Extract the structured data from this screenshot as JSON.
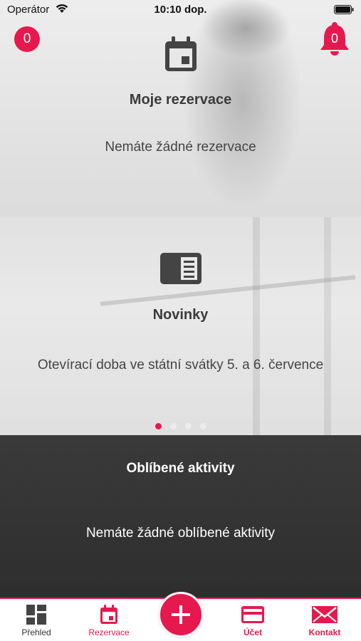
{
  "status_bar": {
    "carrier": "Operátor",
    "time": "10:10 dop."
  },
  "badges": {
    "reservation_count": "0",
    "notification_count": "0"
  },
  "reservations_card": {
    "title": "Moje rezervace",
    "text": "Nemáte žádné rezervace",
    "icon": "calendar-icon"
  },
  "news_card": {
    "title": "Novinky",
    "text": "Otevírací doba ve státní svátky 5. a 6. července",
    "icon": "news-icon",
    "pager": {
      "pages": 4,
      "active_index": 0
    }
  },
  "favorites": {
    "title": "Oblíbené aktivity",
    "text": "Nemáte žádné oblíbené aktivity"
  },
  "tab_bar": {
    "items": [
      {
        "label": "Přehled",
        "icon": "dashboard-icon"
      },
      {
        "label": "Rezervace",
        "icon": "calendar-icon"
      },
      {
        "label": "Účet",
        "icon": "credit-card-icon"
      },
      {
        "label": "Kontakt",
        "icon": "envelope-icon"
      }
    ],
    "center_action_icon": "plus-icon"
  },
  "colors": {
    "accent": "#e5194d",
    "dark_section": "#333333",
    "text_dark": "#3b3b3b"
  }
}
